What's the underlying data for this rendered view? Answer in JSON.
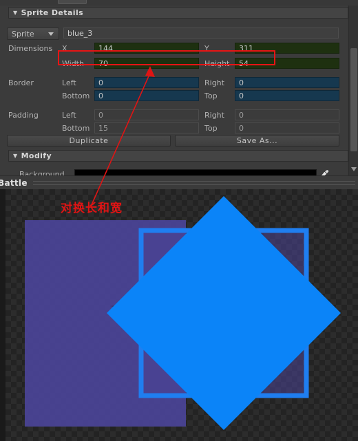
{
  "window": {
    "inspector_title": "Sprite Details",
    "modify_title": "Modify",
    "collapse_triangle": "▼"
  },
  "sprite": {
    "type_dropdown": "Sprite",
    "type_dropdown_caret": "chevron-down-icon",
    "name": "blue_3"
  },
  "dimensions": {
    "label": "Dimensions",
    "x_label": "X",
    "x_value": "144",
    "y_label": "Y",
    "y_value": "311",
    "width_label": "Width",
    "width_value": "70",
    "height_label": "Height",
    "height_value": "54"
  },
  "border": {
    "label": "Border",
    "left_label": "Left",
    "left_value": "0",
    "right_label": "Right",
    "right_value": "0",
    "bottom_label": "Bottom",
    "bottom_value": "0",
    "top_label": "Top",
    "top_value": "0"
  },
  "padding": {
    "label": "Padding",
    "left_label": "Left",
    "left_value": "0",
    "right_label": "Right",
    "right_value": "0",
    "bottom_label": "Bottom",
    "bottom_value": "15",
    "top_label": "Top",
    "top_value": "0"
  },
  "actions": {
    "duplicate": "Duplicate",
    "save_as": "Save As..."
  },
  "modify": {
    "background_label": "Background",
    "background_color": "#000000",
    "eyedropper_icon": "eyedropper-icon"
  },
  "tabbar": {
    "active_tab": "Battle"
  },
  "annotation": {
    "note_text": "对换长和宽",
    "note_color": "#e01414",
    "highlight_color": "#e81414",
    "arrow_color": "#e01414"
  },
  "colors": {
    "panel_bg": "#3b3b3b",
    "field_green": "#1e3010",
    "field_blue": "#16384f",
    "sprite_blue": "#0b84f8",
    "sprite_purple": "#4a4395",
    "canvas_bg": "#232323"
  }
}
